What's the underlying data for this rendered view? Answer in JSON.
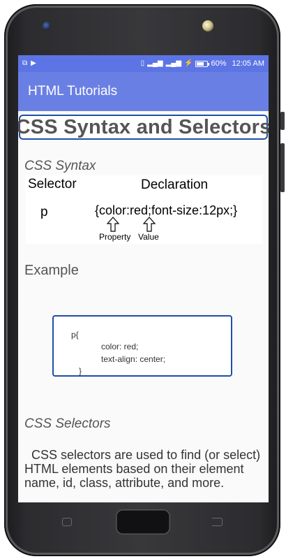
{
  "status_bar": {
    "left_icons": [
      "cast-icon",
      "youtube-icon"
    ],
    "battery_percent": "60%",
    "time": "12:05 AM"
  },
  "app_bar": {
    "title": "HTML Tutorials"
  },
  "page_title": "CSS Syntax and Selectors",
  "css_syntax": {
    "heading": "CSS Syntax",
    "diagram": {
      "selector_label": "Selector",
      "declaration_label": "Declaration",
      "selector_value": "p",
      "declaration_value": "{color:red;font-size:12px;}",
      "property_label": "Property",
      "value_label": "Value"
    }
  },
  "example": {
    "heading": "Example",
    "code_lines": [
      "p{",
      "color: red;",
      "text-align: center;",
      "}"
    ]
  },
  "css_selectors": {
    "heading": "CSS Selectors",
    "paragraph": "CSS selectors are used to find (or select) HTML elements based on their element name, id, class, attribute, and more."
  },
  "colors": {
    "status_bar": "#5c74e4",
    "app_bar": "#6a7fe3",
    "title_border": "#1f4fa8"
  }
}
